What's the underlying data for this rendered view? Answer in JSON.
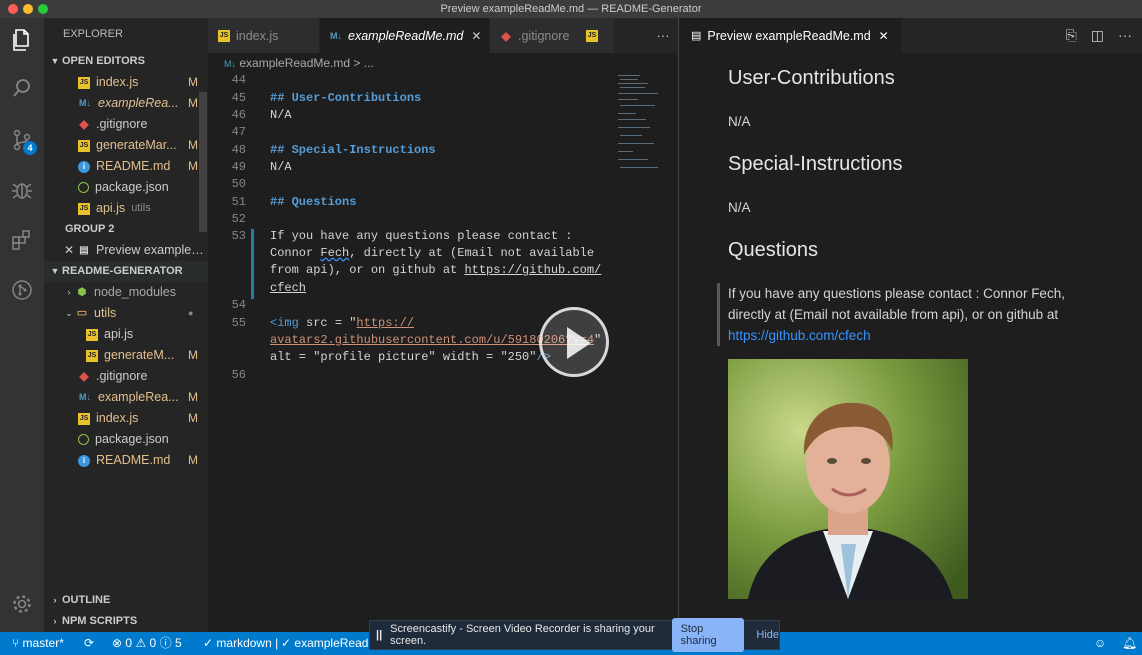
{
  "window": {
    "title": "Preview exampleReadMe.md — README-Generator"
  },
  "activity": {
    "scm_badge": "4"
  },
  "sidebar": {
    "title": "EXPLORER",
    "open_editors_label": "OPEN EDITORS",
    "open_editors": [
      {
        "label": "index.js",
        "status": "M",
        "icon": "js"
      },
      {
        "label": "exampleRea...",
        "status": "M",
        "icon": "md"
      },
      {
        "label": ".gitignore",
        "status": "",
        "icon": "git"
      },
      {
        "label": "generateMar...",
        "status": "M",
        "icon": "js"
      },
      {
        "label": "README.md",
        "status": "M",
        "icon": "info"
      },
      {
        "label": "package.json",
        "status": "",
        "icon": "pkg"
      },
      {
        "label": "api.js",
        "status": "utils",
        "icon": "js"
      }
    ],
    "group2_label": "GROUP 2",
    "group2_item": "Preview exampleR...",
    "project_label": "README-GENERATOR",
    "tree": [
      {
        "label": "node_modules",
        "status": "",
        "icon": "folder"
      },
      {
        "label": "utils",
        "status": "●",
        "icon": "folder"
      },
      {
        "label": "api.js",
        "status": "",
        "icon": "js"
      },
      {
        "label": "generateM...",
        "status": "M",
        "icon": "js"
      },
      {
        "label": ".gitignore",
        "status": "",
        "icon": "git"
      },
      {
        "label": "exampleRea...",
        "status": "M",
        "icon": "md"
      },
      {
        "label": "index.js",
        "status": "M",
        "icon": "js"
      },
      {
        "label": "package.json",
        "status": "",
        "icon": "pkg"
      },
      {
        "label": "README.md",
        "status": "M",
        "icon": "info"
      }
    ],
    "outline_label": "OUTLINE",
    "npm_label": "NPM SCRIPTS"
  },
  "tabs": {
    "tab1": "index.js",
    "tab2": "exampleReadMe.md",
    "tab3": ".gitignore",
    "more": "···"
  },
  "breadcrumb": {
    "file": "exampleReadMe.md",
    "rest": "..."
  },
  "editor": {
    "lines": {
      "44": "44",
      "45": "45",
      "46": "46",
      "47": "47",
      "48": "48",
      "49": "49",
      "50": "50",
      "51": "51",
      "52": "52",
      "53": "53",
      "54": "54",
      "55": "55",
      "56": "56"
    },
    "l45": "## User-Contributions",
    "l46": "N/A",
    "l48": "## Special-Instructions",
    "l49": "N/A",
    "l51": "## Questions",
    "l53a": "If you have any questions please contact :",
    "l53b1": "Connor ",
    "l53b2": "Fech",
    "l53b3": ", directly at (Email not available",
    "l53c1": "from api), or on github at ",
    "l53c2": "https://github.com/",
    "l53d": "cfech",
    "l55a1": "<img",
    "l55a2": " src = \"",
    "l55a3": "https://",
    "l55b": "avatars2.githubusercontent.com/u/59180206?v=4",
    "l55b2": "\"",
    "l55c1": "alt = \"profile picture\" width = \"250\"",
    "l55c2": "/>"
  },
  "preview": {
    "tab_label": "Preview exampleReadMe.md",
    "h_contrib": "User-Contributions",
    "contrib": "N/A",
    "h_special": "Special-Instructions",
    "special": "N/A",
    "h_questions": "Questions",
    "q_text": "If you have any questions please contact : Connor Fech, directly at (Email not available from api), or on github at ",
    "q_link": "https://github.com/cfech"
  },
  "statusbar": {
    "branch": "master*",
    "errors": "0",
    "warnings": "0",
    "info": "5",
    "lang": "markdown |",
    "file": "exampleRead"
  },
  "screencast": {
    "message": "Screencastify - Screen Video Recorder is sharing your screen.",
    "stop_label": "Stop sharing",
    "hide_label": "Hide"
  },
  "colors": {
    "accent": "#007acc",
    "link": "#3794ff",
    "modified": "#e2c08d"
  }
}
